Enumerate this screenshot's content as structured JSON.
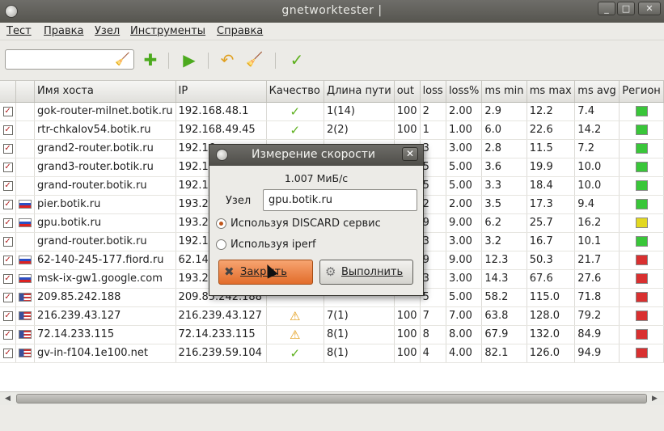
{
  "window": {
    "title": "gnetworktester |",
    "minimize": "_",
    "maximize": "□",
    "close": "✕"
  },
  "menu": [
    "Тест",
    "Правка",
    "Узел",
    "Инструменты",
    "Справка"
  ],
  "toolbar": {
    "combo_value": ""
  },
  "columns": [
    "",
    "",
    "Имя хоста",
    "IP",
    "Качество",
    "Длина пути",
    "out",
    "loss",
    "loss%",
    "ms min",
    "ms max",
    "ms avg",
    "Регион"
  ],
  "rows": [
    {
      "flag": "",
      "host": "gok-router-milnet.botik.ru",
      "ip": "192.168.48.1",
      "q": "ok",
      "path": "1(14)",
      "out": "100",
      "loss": "2",
      "lossp": "2.00",
      "min": "2.9",
      "max": "12.2",
      "avg": "7.4",
      "region": "#39c639"
    },
    {
      "flag": "",
      "host": "rtr-chkalov54.botik.ru",
      "ip": "192.168.49.45",
      "q": "ok",
      "path": "2(2)",
      "out": "100",
      "loss": "1",
      "lossp": "1.00",
      "min": "6.0",
      "max": "22.6",
      "avg": "14.2",
      "region": "#39c639"
    },
    {
      "flag": "",
      "host": "grand2-router.botik.ru",
      "ip": "192.16",
      "q": "",
      "path": "",
      "out": "",
      "loss": "3",
      "lossp": "3.00",
      "min": "2.8",
      "max": "11.5",
      "avg": "7.2",
      "region": "#39c639"
    },
    {
      "flag": "",
      "host": "grand3-router.botik.ru",
      "ip": "192.16",
      "q": "",
      "path": "",
      "out": "",
      "loss": "5",
      "lossp": "5.00",
      "min": "3.6",
      "max": "19.9",
      "avg": "10.0",
      "region": "#39c639"
    },
    {
      "flag": "",
      "host": "grand-router.botik.ru",
      "ip": "192.16",
      "q": "",
      "path": "",
      "out": "",
      "loss": "5",
      "lossp": "5.00",
      "min": "3.3",
      "max": "18.4",
      "avg": "10.0",
      "region": "#39c639"
    },
    {
      "flag": "ru",
      "host": "pier.botik.ru",
      "ip": "193.23",
      "q": "",
      "path": "",
      "out": "",
      "loss": "2",
      "lossp": "2.00",
      "min": "3.5",
      "max": "17.3",
      "avg": "9.4",
      "region": "#39c639"
    },
    {
      "flag": "ru",
      "host": "gpu.botik.ru",
      "ip": "193.23",
      "q": "",
      "path": "",
      "out": "",
      "loss": "9",
      "lossp": "9.00",
      "min": "6.2",
      "max": "25.7",
      "avg": "16.2",
      "region": "#e2d820"
    },
    {
      "flag": "",
      "host": "grand-router.botik.ru",
      "ip": "192.16",
      "q": "",
      "path": "",
      "out": "",
      "loss": "3",
      "lossp": "3.00",
      "min": "3.2",
      "max": "16.7",
      "avg": "10.1",
      "region": "#39c639"
    },
    {
      "flag": "ru",
      "host": "62-140-245-177.fiord.ru",
      "ip": "62.140",
      "q": "",
      "path": "",
      "out": "",
      "loss": "9",
      "lossp": "9.00",
      "min": "12.3",
      "max": "50.3",
      "avg": "21.7",
      "region": "#d93030"
    },
    {
      "flag": "ru",
      "host": "msk-ix-gw1.google.com",
      "ip": "193.23",
      "q": "",
      "path": "",
      "out": "",
      "loss": "3",
      "lossp": "3.00",
      "min": "14.3",
      "max": "67.6",
      "avg": "27.6",
      "region": "#d93030"
    },
    {
      "flag": "us",
      "host": "209.85.242.188",
      "ip": "209.85.242.188",
      "q": "",
      "path": "",
      "out": "",
      "loss": "5",
      "lossp": "5.00",
      "min": "58.2",
      "max": "115.0",
      "avg": "71.8",
      "region": "#d93030"
    },
    {
      "flag": "us",
      "host": "216.239.43.127",
      "ip": "216.239.43.127",
      "q": "warn",
      "path": "7(1)",
      "out": "100",
      "loss": "7",
      "lossp": "7.00",
      "min": "63.8",
      "max": "128.0",
      "avg": "79.2",
      "region": "#d93030"
    },
    {
      "flag": "us",
      "host": "72.14.233.115",
      "ip": "72.14.233.115",
      "q": "warn",
      "path": "8(1)",
      "out": "100",
      "loss": "8",
      "lossp": "8.00",
      "min": "67.9",
      "max": "132.0",
      "avg": "84.9",
      "region": "#d93030"
    },
    {
      "flag": "us",
      "host": "gv-in-f104.1e100.net",
      "ip": "216.239.59.104",
      "q": "ok",
      "path": "8(1)",
      "out": "100",
      "loss": "4",
      "lossp": "4.00",
      "min": "82.1",
      "max": "126.0",
      "avg": "94.9",
      "region": "#d93030"
    }
  ],
  "dialog": {
    "title": "Измерение скорости",
    "speed": "1.007 МиБ/с",
    "host_label": "Узел",
    "host_value": "gpu.botik.ru",
    "radio_discard": "Используя DISCARD сервис",
    "radio_iperf": "Используя iperf",
    "close_btn": "Закрыть",
    "run_btn": "Выполнить"
  }
}
